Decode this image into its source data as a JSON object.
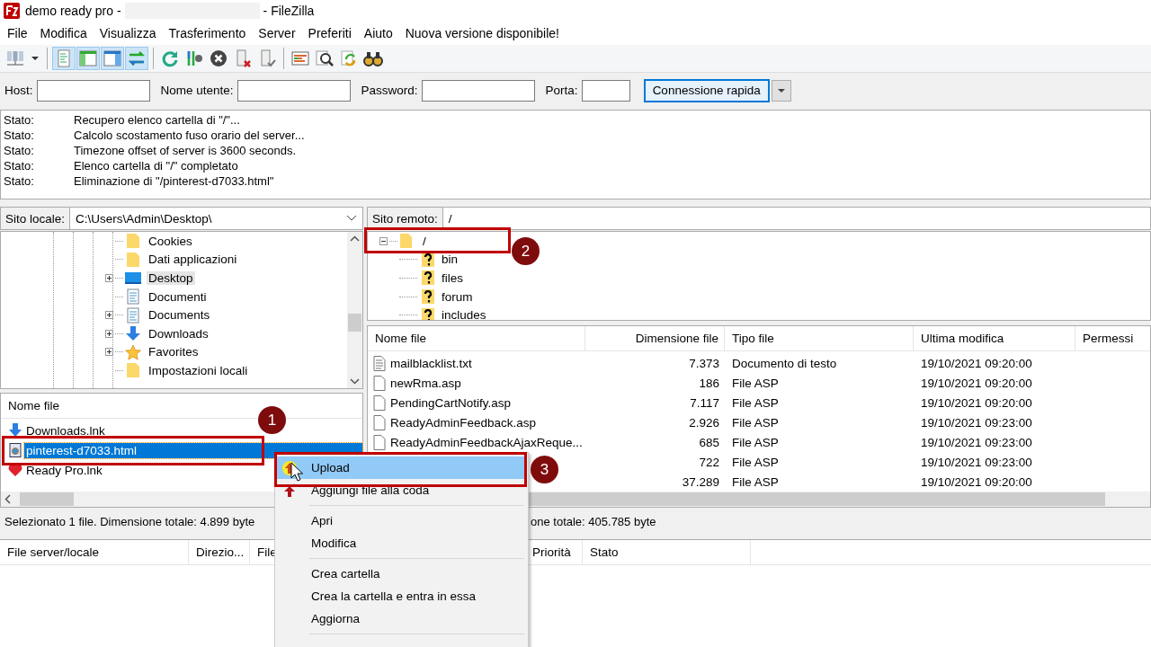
{
  "window": {
    "title_start": "demo ready pro -",
    "title_end": "- FileZilla"
  },
  "menu": [
    "File",
    "Modifica",
    "Visualizza",
    "Trasferimento",
    "Server",
    "Preferiti",
    "Aiuto",
    "Nuova versione disponibile!"
  ],
  "toolbar": [
    {
      "kind": "sites"
    },
    {
      "kind": "dropdown"
    },
    {
      "kind": "sep"
    },
    {
      "kind": "log",
      "on": true
    },
    {
      "kind": "localtree",
      "on": true
    },
    {
      "kind": "remotetree",
      "on": true
    },
    {
      "kind": "queue",
      "on": true
    },
    {
      "kind": "sep"
    },
    {
      "kind": "refresh"
    },
    {
      "kind": "filter"
    },
    {
      "kind": "cancel"
    },
    {
      "kind": "disconnect"
    },
    {
      "kind": "reconnect"
    },
    {
      "kind": "sep"
    },
    {
      "kind": "compare"
    },
    {
      "kind": "search"
    },
    {
      "kind": "sync"
    },
    {
      "kind": "find"
    }
  ],
  "quickconnect": {
    "fields": [
      {
        "label": "Host:"
      },
      {
        "label": "Nome utente:"
      },
      {
        "label": "Password:"
      },
      {
        "label": "Porta:"
      }
    ],
    "button": "Connessione rapida"
  },
  "log": [
    {
      "label": "Stato:",
      "text": "Recupero elenco cartella di \"/\"..."
    },
    {
      "label": "Stato:",
      "text": "Calcolo scostamento fuso orario del server..."
    },
    {
      "label": "Stato:",
      "text": "Timezone offset of server is 3600 seconds."
    },
    {
      "label": "Stato:",
      "text": "Elenco cartella di \"/\" completato"
    },
    {
      "label": "Stato:",
      "text": "Eliminazione di \"/pinterest-d7033.html\""
    }
  ],
  "local": {
    "label": "Sito locale:",
    "path": "C:\\Users\\Admin\\Desktop\\",
    "tree": [
      {
        "name": "Cookies",
        "kind": "folder",
        "expandable": false,
        "selected": false
      },
      {
        "name": "Dati applicazioni",
        "kind": "folder",
        "expandable": false,
        "selected": false
      },
      {
        "name": "Desktop",
        "kind": "desktop",
        "expandable": true,
        "selected": true
      },
      {
        "name": "Documenti",
        "kind": "document",
        "expandable": false,
        "selected": false
      },
      {
        "name": "Documents",
        "kind": "document",
        "expandable": true,
        "selected": false
      },
      {
        "name": "Downloads",
        "kind": "download",
        "expandable": true,
        "selected": false
      },
      {
        "name": "Favorites",
        "kind": "star",
        "expandable": true,
        "selected": false
      },
      {
        "name": "Impostazioni locali",
        "kind": "folder",
        "expandable": false,
        "selected": false
      }
    ],
    "columns": [
      "Nome file"
    ],
    "files": [
      {
        "name": "Downloads.lnk",
        "kind": "download",
        "selected": false
      },
      {
        "name": "pinterest-d7033.html",
        "kind": "html",
        "selected": true
      },
      {
        "name": "Ready Pro.lnk",
        "kind": "heart",
        "selected": false
      }
    ]
  },
  "remote": {
    "label": "Sito remoto:",
    "path": "/",
    "tree": [
      {
        "name": "/",
        "expanded": true,
        "children": [
          {
            "name": "bin"
          },
          {
            "name": "files"
          },
          {
            "name": "forum"
          },
          {
            "name": "includes"
          }
        ]
      }
    ],
    "columns": [
      "Nome file",
      "Dimensione file",
      "Tipo file",
      "Ultima modifica",
      "Permessi"
    ],
    "files": [
      {
        "name": "mailblacklist.txt",
        "kind": "text",
        "size": "7.373",
        "type": "Documento di testo",
        "modified": "19/10/2021 09:20:00"
      },
      {
        "name": "newRma.asp",
        "kind": "file",
        "size": "186",
        "type": "File ASP",
        "modified": "19/10/2021 09:20:00"
      },
      {
        "name": "PendingCartNotify.asp",
        "kind": "file",
        "size": "7.117",
        "type": "File ASP",
        "modified": "19/10/2021 09:20:00"
      },
      {
        "name": "ReadyAdminFeedback.asp",
        "kind": "file",
        "size": "2.926",
        "type": "File ASP",
        "modified": "19/10/2021 09:23:00"
      },
      {
        "name": "ReadyAdminFeedbackAjaxReque...",
        "kind": "file",
        "size": "685",
        "type": "File ASP",
        "modified": "19/10/2021 09:23:00"
      },
      {
        "size": "722",
        "type": "File ASP",
        "modified": "19/10/2021 09:23:00"
      },
      {
        "size": "37.289",
        "type": "File ASP",
        "modified": "19/10/2021 09:20:00"
      }
    ]
  },
  "status": [
    "Selezionato 1 file. Dimensione totale: 4.899 byte",
    "one totale: 405.785 byte"
  ],
  "queue": {
    "columns": [
      "File server/locale",
      "Direzio...",
      "File",
      "Priorità",
      "Stato"
    ]
  },
  "context_menu": [
    {
      "kind": "upload",
      "label": "Upload",
      "selected": true
    },
    {
      "kind": "queue",
      "label": "Aggiungi file alla coda",
      "selected": false
    },
    {
      "kind": "separator"
    },
    {
      "kind": "item",
      "label": "Apri",
      "selected": false
    },
    {
      "kind": "item",
      "label": "Modifica",
      "selected": false
    },
    {
      "kind": "separator"
    },
    {
      "kind": "item",
      "label": "Crea cartella",
      "selected": false
    },
    {
      "kind": "item",
      "label": "Crea la cartella e entra in essa",
      "selected": false
    },
    {
      "kind": "item",
      "label": "Aggiorna",
      "selected": false
    },
    {
      "kind": "separator"
    }
  ],
  "annotations": [
    {
      "number": "1"
    },
    {
      "number": "2"
    },
    {
      "number": "3"
    }
  ]
}
